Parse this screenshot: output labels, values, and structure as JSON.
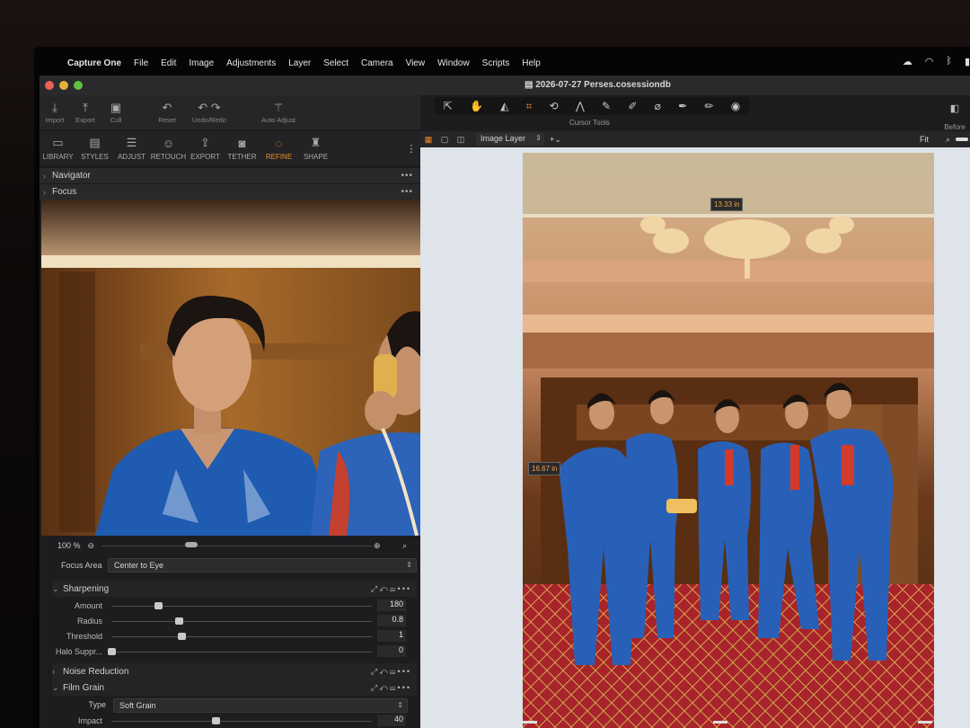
{
  "menubar": {
    "app_name": "Capture One",
    "items": [
      "File",
      "Edit",
      "Image",
      "Adjustments",
      "Layer",
      "Select",
      "Camera",
      "View",
      "Window",
      "Scripts",
      "Help"
    ]
  },
  "window": {
    "title": "2026-07-27 Perses.cosessiondb"
  },
  "toolbar": {
    "import": "Import",
    "export": "Export",
    "cull": "Cull",
    "reset": "Reset",
    "undo_redo": "Undo/Redo",
    "auto_adjust": "Auto Adjust",
    "cursor_tools_label": "Cursor Tools",
    "before": "Before"
  },
  "tool_tabs": [
    "LIBRARY",
    "STYLES",
    "ADJUST",
    "RETOUCH",
    "EXPORT",
    "TETHER",
    "REFINE",
    "SHAPE"
  ],
  "active_tool_tab": "REFINE",
  "panels": {
    "navigator": "Navigator",
    "focus": "Focus"
  },
  "focus": {
    "zoom": "100 %",
    "focus_area_label": "Focus Area",
    "focus_area_value": "Center to Eye"
  },
  "sharpening": {
    "title": "Sharpening",
    "sliders": [
      {
        "name": "Amount",
        "value": "180",
        "pos": 0.18
      },
      {
        "name": "Radius",
        "value": "0.8",
        "pos": 0.26
      },
      {
        "name": "Threshold",
        "value": "1",
        "pos": 0.27
      },
      {
        "name": "Halo Suppr...",
        "value": "0",
        "pos": 0.0
      }
    ]
  },
  "noise_reduction": {
    "title": "Noise Reduction"
  },
  "film_grain": {
    "title": "Film Grain",
    "type_label": "Type",
    "type_value": "Soft Grain",
    "impact_label": "Impact",
    "impact_value": "40",
    "impact_pos": 0.4
  },
  "viewer": {
    "layer": "Image Layer",
    "fit": "Fit",
    "measure_width": "13.33 in",
    "measure_height": "16.67 in"
  },
  "colors": {
    "accent": "#f08a24",
    "panel": "#1d1d1f",
    "viewer_bg": "#dfe3ea"
  }
}
